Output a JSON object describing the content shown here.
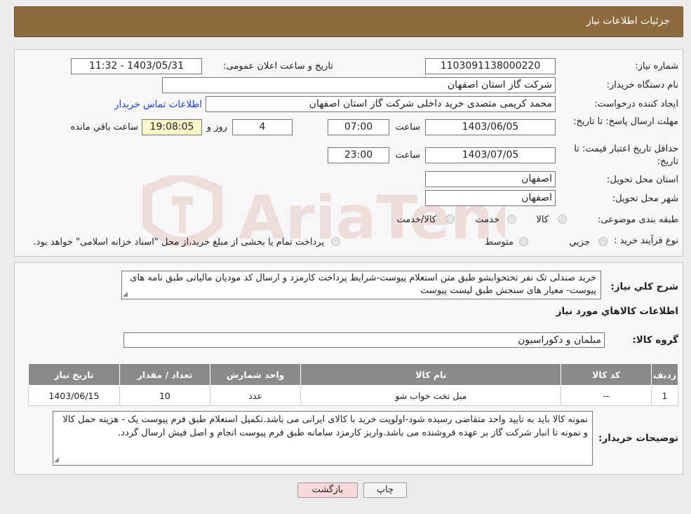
{
  "header": {
    "title": "جزئیات اطلاعات نیاز"
  },
  "fields": {
    "need_number_label": "شماره نیاز:",
    "need_number": "1103091138000220",
    "announce_label": "تاریخ و ساعت اعلان عمومی:",
    "announce_value": "1403/05/31 - 11:32",
    "buyer_org_label": "نام دستگاه خریدار:",
    "buyer_org": "شرکت گاز استان اصفهان",
    "creator_label": "ایجاد کننده درخواست:",
    "creator": "محمد کریمی متصدی خرید داخلی شرکت گاز استان اصفهان",
    "contact_link": "اطلاعات تماس خریدار",
    "reply_deadline_label": "مهلت ارسال پاسخ: تا تاریخ:",
    "reply_date": "1403/06/05",
    "time_label": "ساعت",
    "reply_time": "07:00",
    "days": "4",
    "days_label": "روز و",
    "remaining_time": "19:08:05",
    "remaining_label": "ساعت باقي مانده",
    "price_validity_label": "حداقل تاریخ اعتبار قیمت: تا تاریخ:",
    "validity_date": "1403/07/05",
    "validity_time": "23:00",
    "province_label": "استان محل تحویل:",
    "province": "اصفهان",
    "city_label": "شهر محل تحویل:",
    "city": "اصفهان",
    "category_label": "طبقه بندی موضوعی:",
    "category_options": [
      "کالا",
      "خدمت",
      "کالا/خدمت"
    ],
    "process_label": "نوع فرآیند خرید :",
    "process_options": [
      "جزيي",
      "متوسط"
    ],
    "process_note": "پرداخت تمام یا بخشی از مبلغ خرید،از محل \"اسناد خزانه اسلامی\" خواهد بود."
  },
  "description": {
    "label": "شرح کلي نياز:",
    "text": "خرید صندلی تک نفر تختخوابشو طبق متن استعلام پیوست-شرایط پرداخت کارمزد و ارسال کد مودیان مالیاتی طبق نامه های پیوست- معیار های سنجش طبق لیست پیوست"
  },
  "goods_section_title": "اطلاعات کالاهاي مورد نياز",
  "goods_group": {
    "label": "گروه کالا:",
    "value": "مبلمان و دکوراسیون"
  },
  "table": {
    "headers": [
      "رديف",
      "کد کالا",
      "نام کالا",
      "واحد شمارش",
      "تعداد / مقدار",
      "تاريخ نياز"
    ],
    "rows": [
      [
        "1",
        "--",
        "مبل تخت خواب شو",
        "عدد",
        "10",
        "1403/06/15"
      ]
    ]
  },
  "buyer_notes": {
    "label": "توضیحات خریدار:",
    "text": "نمونه کالا باید به تایید واحد متقاضی رسیده شود-اولویت خرید با کالای ایرانی می باشد.تکمیل استعلام طبق فرم پیوست یک - هزینه حمل کالا و نمونه تا انبار شرکت گاز بر عهده فروشنده می باشد.واریز کارمزد سامانه طبق فرم پیوست انجام و اصل فیش ارسال گردد."
  },
  "buttons": {
    "print": "چاپ",
    "back": "بازگشت"
  },
  "colors": {
    "header": "#8c6a3d",
    "back_button": "#f7d9d9",
    "link": "#1a3fd6"
  }
}
